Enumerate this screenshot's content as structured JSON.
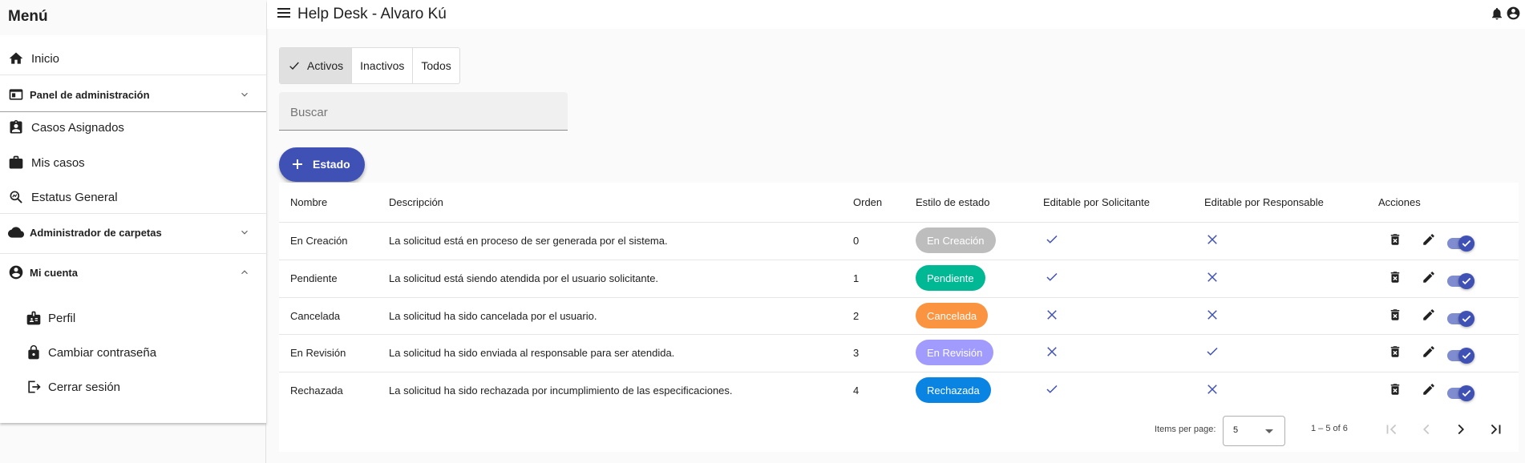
{
  "sidebar": {
    "title": "Menú",
    "items": [
      {
        "label": "Inicio",
        "icon": "home-icon"
      },
      {
        "label": "Panel de administración",
        "icon": "dashboard-icon"
      },
      {
        "label": "Casos Asignados",
        "icon": "assignment-ind-icon"
      },
      {
        "label": "Mis casos",
        "icon": "briefcase-icon"
      },
      {
        "label": "Estatus General",
        "icon": "search-chart-icon"
      },
      {
        "label": "Administrador de carpetas",
        "icon": "cloud-icon"
      },
      {
        "label": "Mi cuenta",
        "icon": "account-circle-icon"
      }
    ],
    "account_sub": [
      {
        "label": "Perfil",
        "icon": "badge-icon"
      },
      {
        "label": "Cambiar contraseña",
        "icon": "lock-icon"
      },
      {
        "label": "Cerrar sesión",
        "icon": "logout-icon"
      }
    ]
  },
  "header": {
    "title": "Help Desk - Alvaro Kú"
  },
  "filters": {
    "tabs": [
      {
        "label": "Activos",
        "active": true
      },
      {
        "label": "Inactivos",
        "active": false
      },
      {
        "label": "Todos",
        "active": false
      }
    ]
  },
  "search": {
    "placeholder": "Buscar",
    "value": ""
  },
  "add_button": {
    "label": "Estado"
  },
  "table": {
    "columns": [
      "Nombre",
      "Descripción",
      "Orden",
      "Estilo de estado",
      "Editable por Solicitante",
      "Editable por Responsable",
      "Acciones"
    ],
    "rows": [
      {
        "nombre": "En Creación",
        "descripcion": "La solicitud está en proceso de ser generada por el sistema.",
        "orden": "0",
        "estilo": "En Creación",
        "color": "#bdbdbd",
        "solicitante": true,
        "responsable": false
      },
      {
        "nombre": "Pendiente",
        "descripcion": "La solicitud está siendo atendida por el usuario solicitante.",
        "orden": "1",
        "estilo": "Pendiente",
        "color": "#00b894",
        "solicitante": true,
        "responsable": false
      },
      {
        "nombre": "Cancelada",
        "descripcion": "La solicitud ha sido cancelada por el usuario.",
        "orden": "2",
        "estilo": "Cancelada",
        "color": "#fb9440",
        "solicitante": false,
        "responsable": false
      },
      {
        "nombre": "En Revisión",
        "descripcion": "La solicitud ha sido enviada al responsable para ser atendida.",
        "orden": "3",
        "estilo": "En Revisión",
        "color": "#a29bfe",
        "solicitante": false,
        "responsable": true
      },
      {
        "nombre": "Rechazada",
        "descripcion": "La solicitud ha sido rechazada por incumplimiento de las especificaciones.",
        "orden": "4",
        "estilo": "Rechazada",
        "color": "#0984e3",
        "solicitante": true,
        "responsable": false
      }
    ]
  },
  "paginator": {
    "items_label": "Items per page:",
    "page_size": "5",
    "range": "1 – 5 of 6"
  },
  "colors": {
    "primary": "#3f51b5",
    "toggle_track": "#7f8ccf"
  }
}
